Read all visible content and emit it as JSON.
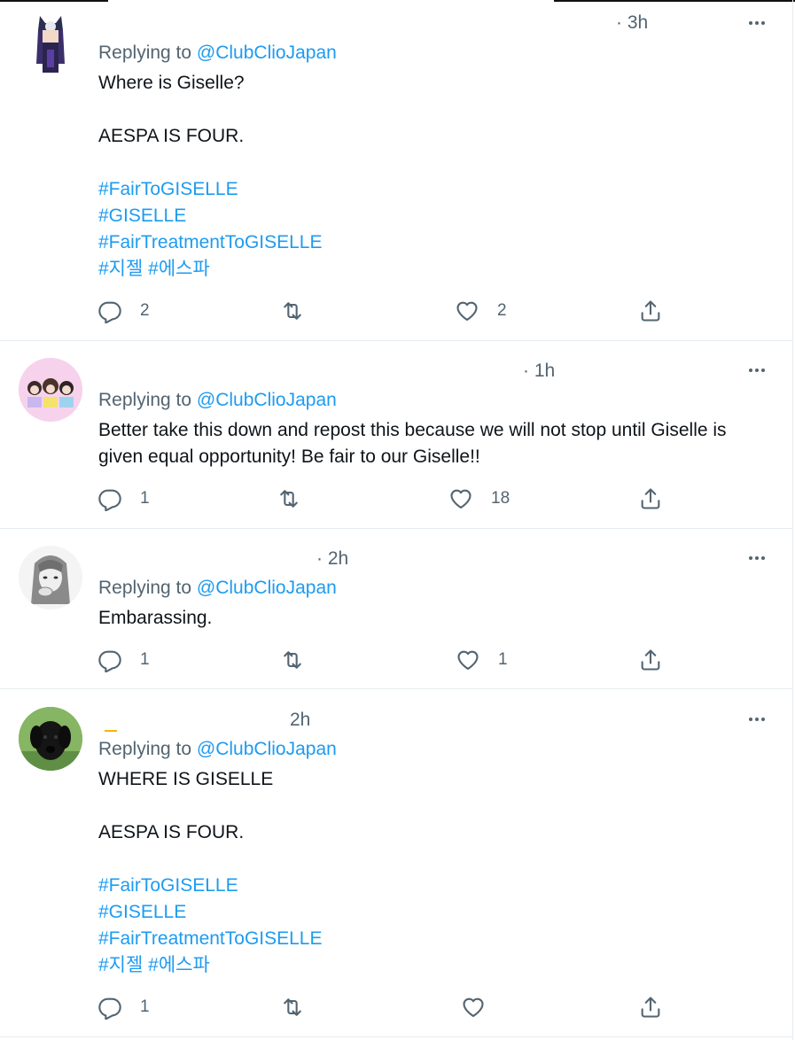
{
  "tweets": [
    {
      "time": "· 3h",
      "replying_prefix": "Replying to",
      "mention": "@ClubClioJapan",
      "lines": [
        {
          "text": "Where is Giselle?",
          "tag": false
        },
        {
          "text": "",
          "tag": false
        },
        {
          "text": "AESPA IS FOUR.",
          "tag": false
        },
        {
          "text": "",
          "tag": false
        },
        {
          "text": "#FairToGISELLE",
          "tag": true
        },
        {
          "text": "#GISELLE",
          "tag": true
        },
        {
          "text": "#FairTreatmentToGISELLE",
          "tag": true
        },
        {
          "text": "#지젤 #에스파",
          "tag": true
        }
      ],
      "reply_count": "2",
      "retweet_count": "",
      "like_count": "2"
    },
    {
      "time": "· 1h",
      "replying_prefix": "Replying to",
      "mention": "@ClubClioJapan",
      "lines": [
        {
          "text": "Better take this down and repost this because we will not stop until Giselle is given equal opportunity! Be fair to our Giselle!!",
          "tag": false
        }
      ],
      "reply_count": "1",
      "retweet_count": "",
      "like_count": "18"
    },
    {
      "time": "· 2h",
      "replying_prefix": "Replying to",
      "mention": "@ClubClioJapan",
      "lines": [
        {
          "text": "Embarassing.",
          "tag": false
        }
      ],
      "reply_count": "1",
      "retweet_count": "",
      "like_count": "1"
    },
    {
      "time": "2h",
      "replying_prefix": "Replying to",
      "mention": "@ClubClioJapan",
      "lines": [
        {
          "text": "WHERE IS GISELLE",
          "tag": false
        },
        {
          "text": "",
          "tag": false
        },
        {
          "text": "AESPA IS FOUR.",
          "tag": false
        },
        {
          "text": "",
          "tag": false
        },
        {
          "text": "#FairToGISELLE",
          "tag": true
        },
        {
          "text": "#GISELLE",
          "tag": true
        },
        {
          "text": "#FairTreatmentToGISELLE",
          "tag": true
        },
        {
          "text": "#지젤 #에스파",
          "tag": true
        }
      ],
      "reply_count": "1",
      "retweet_count": "",
      "like_count": ""
    }
  ],
  "colors": {
    "accent": "#1d9bf0",
    "secondary_text": "#536471",
    "primary_text": "#0f1419",
    "divider": "#e6ecf0"
  },
  "icons": [
    "more-icon",
    "reply-icon",
    "retweet-icon",
    "like-icon",
    "share-icon"
  ]
}
